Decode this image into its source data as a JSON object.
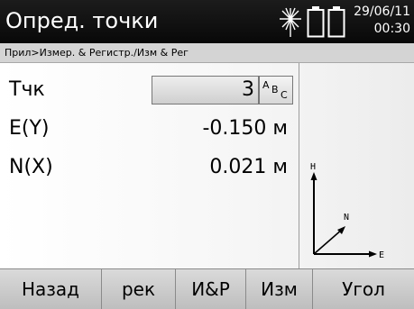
{
  "window": {
    "title": "Опред. точки",
    "date": "29/06/11",
    "time": "00:30",
    "status_icons": [
      "laser-icon",
      "battery-1-icon",
      "battery-2-icon"
    ]
  },
  "breadcrumb": "Прил>Измер. & Регистр./Изм & Рег",
  "fields": {
    "point": {
      "label": "Тчк",
      "value": "3"
    },
    "easting": {
      "label": "E(Y)",
      "value": "-0.150 м"
    },
    "northing": {
      "label": "N(X)",
      "value": "0.021 м"
    }
  },
  "input_mode_button": {
    "letters": [
      "A",
      "B",
      "C"
    ]
  },
  "axes_diagram": {
    "vertical_label": "H",
    "diagonal_label": "N",
    "horizontal_label": "E"
  },
  "softkeys": [
    "Назад",
    "рек",
    "И&Р",
    "Изм",
    "Угол"
  ],
  "colors": {
    "titlebar": "#0a0a0a",
    "text": "#000000",
    "breadcrumb_bg": "#d4d4d4"
  }
}
